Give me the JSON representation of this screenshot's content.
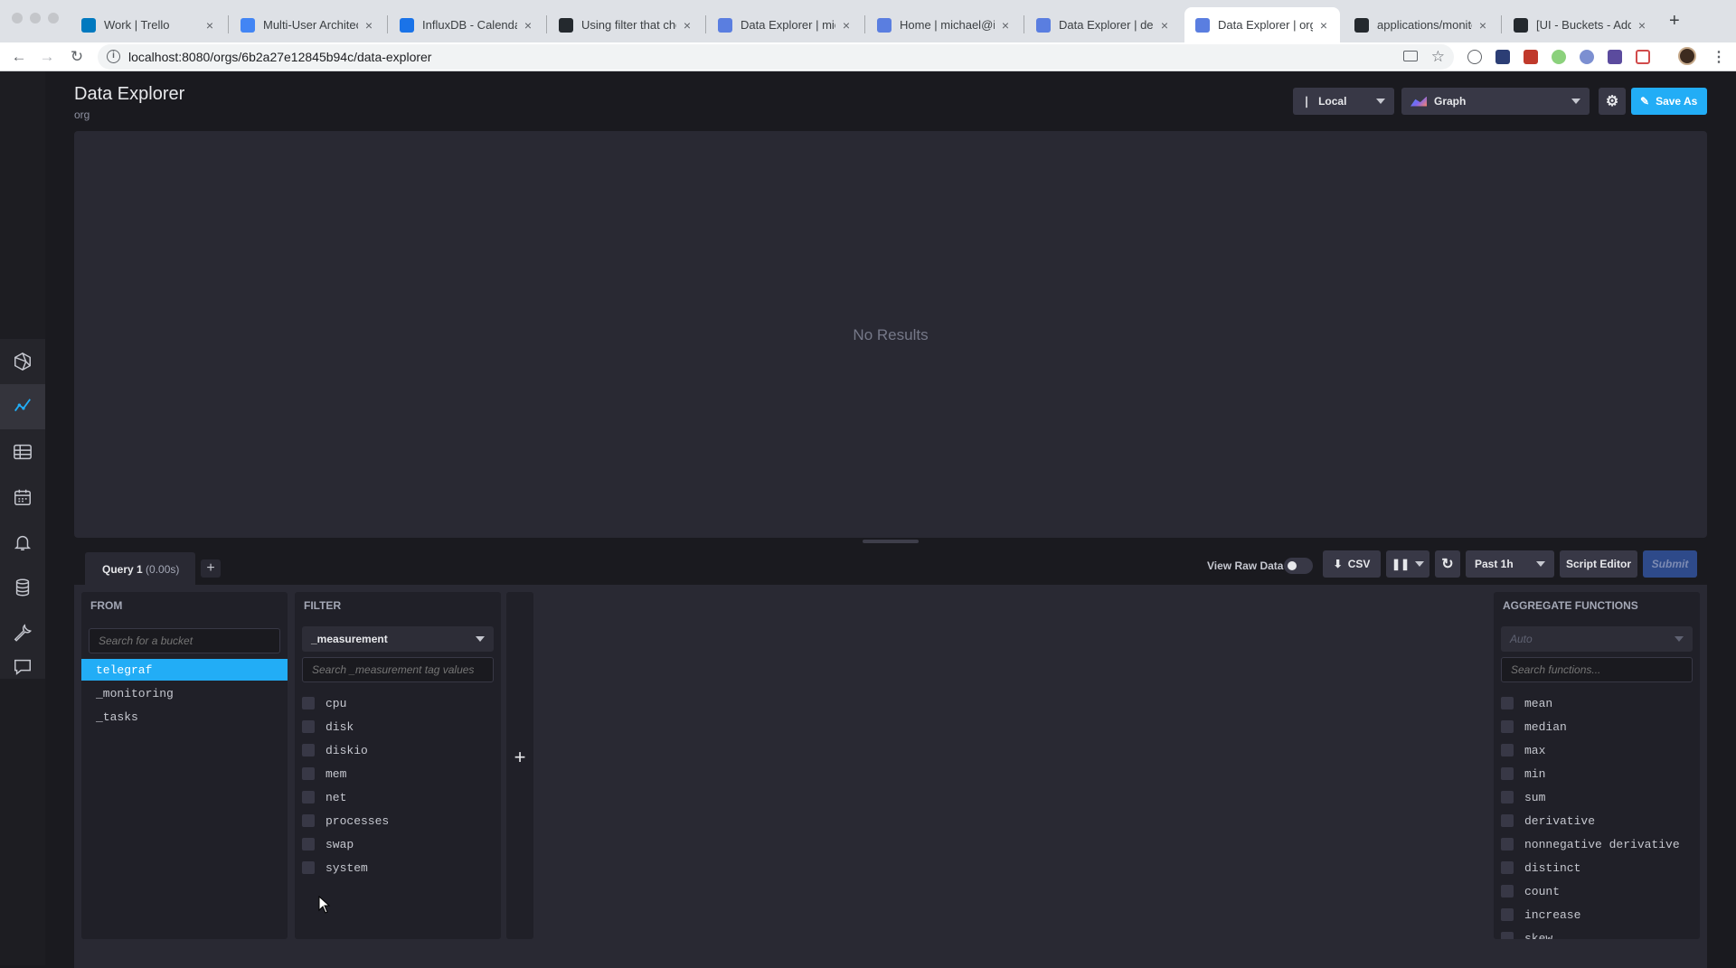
{
  "browser": {
    "tabs": [
      {
        "label": "Work | Trello",
        "icon": "trello-icon",
        "color": "#0079bf"
      },
      {
        "label": "Multi-User Architecture",
        "icon": "google-docs-icon",
        "color": "#4285f4"
      },
      {
        "label": "InfluxDB - Calendar",
        "icon": "calendar-icon",
        "color": "#1a73e8"
      },
      {
        "label": "Using filter that checks",
        "icon": "github-icon",
        "color": "#24292e"
      },
      {
        "label": "Data Explorer | michael",
        "icon": "influx-icon",
        "color": "#5a7ee0"
      },
      {
        "label": "Home | michael@influx",
        "icon": "influx-icon",
        "color": "#5a7ee0"
      },
      {
        "label": "Data Explorer | desa",
        "icon": "influx-icon",
        "color": "#5a7ee0"
      },
      {
        "label": "Data Explorer | org | ",
        "icon": "influx-icon",
        "color": "#5a7ee0",
        "active": true
      },
      {
        "label": "applications/monitoring",
        "icon": "github-icon",
        "color": "#24292e"
      },
      {
        "label": "[UI - Buckets - Add",
        "icon": "github-icon",
        "color": "#24292e"
      }
    ],
    "url": "localhost:8080/orgs/6b2a27e12845b94c/data-explorer"
  },
  "page": {
    "title": "Data Explorer",
    "subtitle": "org"
  },
  "header_controls": {
    "timezone": "Local",
    "vis_type": "Graph",
    "save_label": "Save As"
  },
  "graph": {
    "empty_text": "No Results"
  },
  "query_bar": {
    "query_name": "Query 1",
    "query_time": "(0.00s)",
    "view_raw_label": "View Raw Data",
    "csv_label": "CSV",
    "time_range": "Past 1h",
    "script_editor_label": "Script Editor",
    "submit_label": "Submit"
  },
  "from_card": {
    "header": "FROM",
    "search_placeholder": "Search for a bucket",
    "buckets": [
      "telegraf",
      "_monitoring",
      "_tasks"
    ],
    "selected": "telegraf"
  },
  "filter_card": {
    "header": "FILTER",
    "key": "_measurement",
    "search_placeholder": "Search _measurement tag values",
    "values": [
      "cpu",
      "disk",
      "diskio",
      "mem",
      "net",
      "processes",
      "swap",
      "system"
    ]
  },
  "aggregate_card": {
    "header": "AGGREGATE FUNCTIONS",
    "window": "Auto",
    "search_placeholder": "Search functions...",
    "functions": [
      "mean",
      "median",
      "max",
      "min",
      "sum",
      "derivative",
      "nonnegative derivative",
      "distinct",
      "count",
      "increase",
      "skew"
    ]
  },
  "colors": {
    "accent": "#22adf6",
    "background": "#1a1a1f",
    "panel": "#292933",
    "card": "#202028"
  }
}
